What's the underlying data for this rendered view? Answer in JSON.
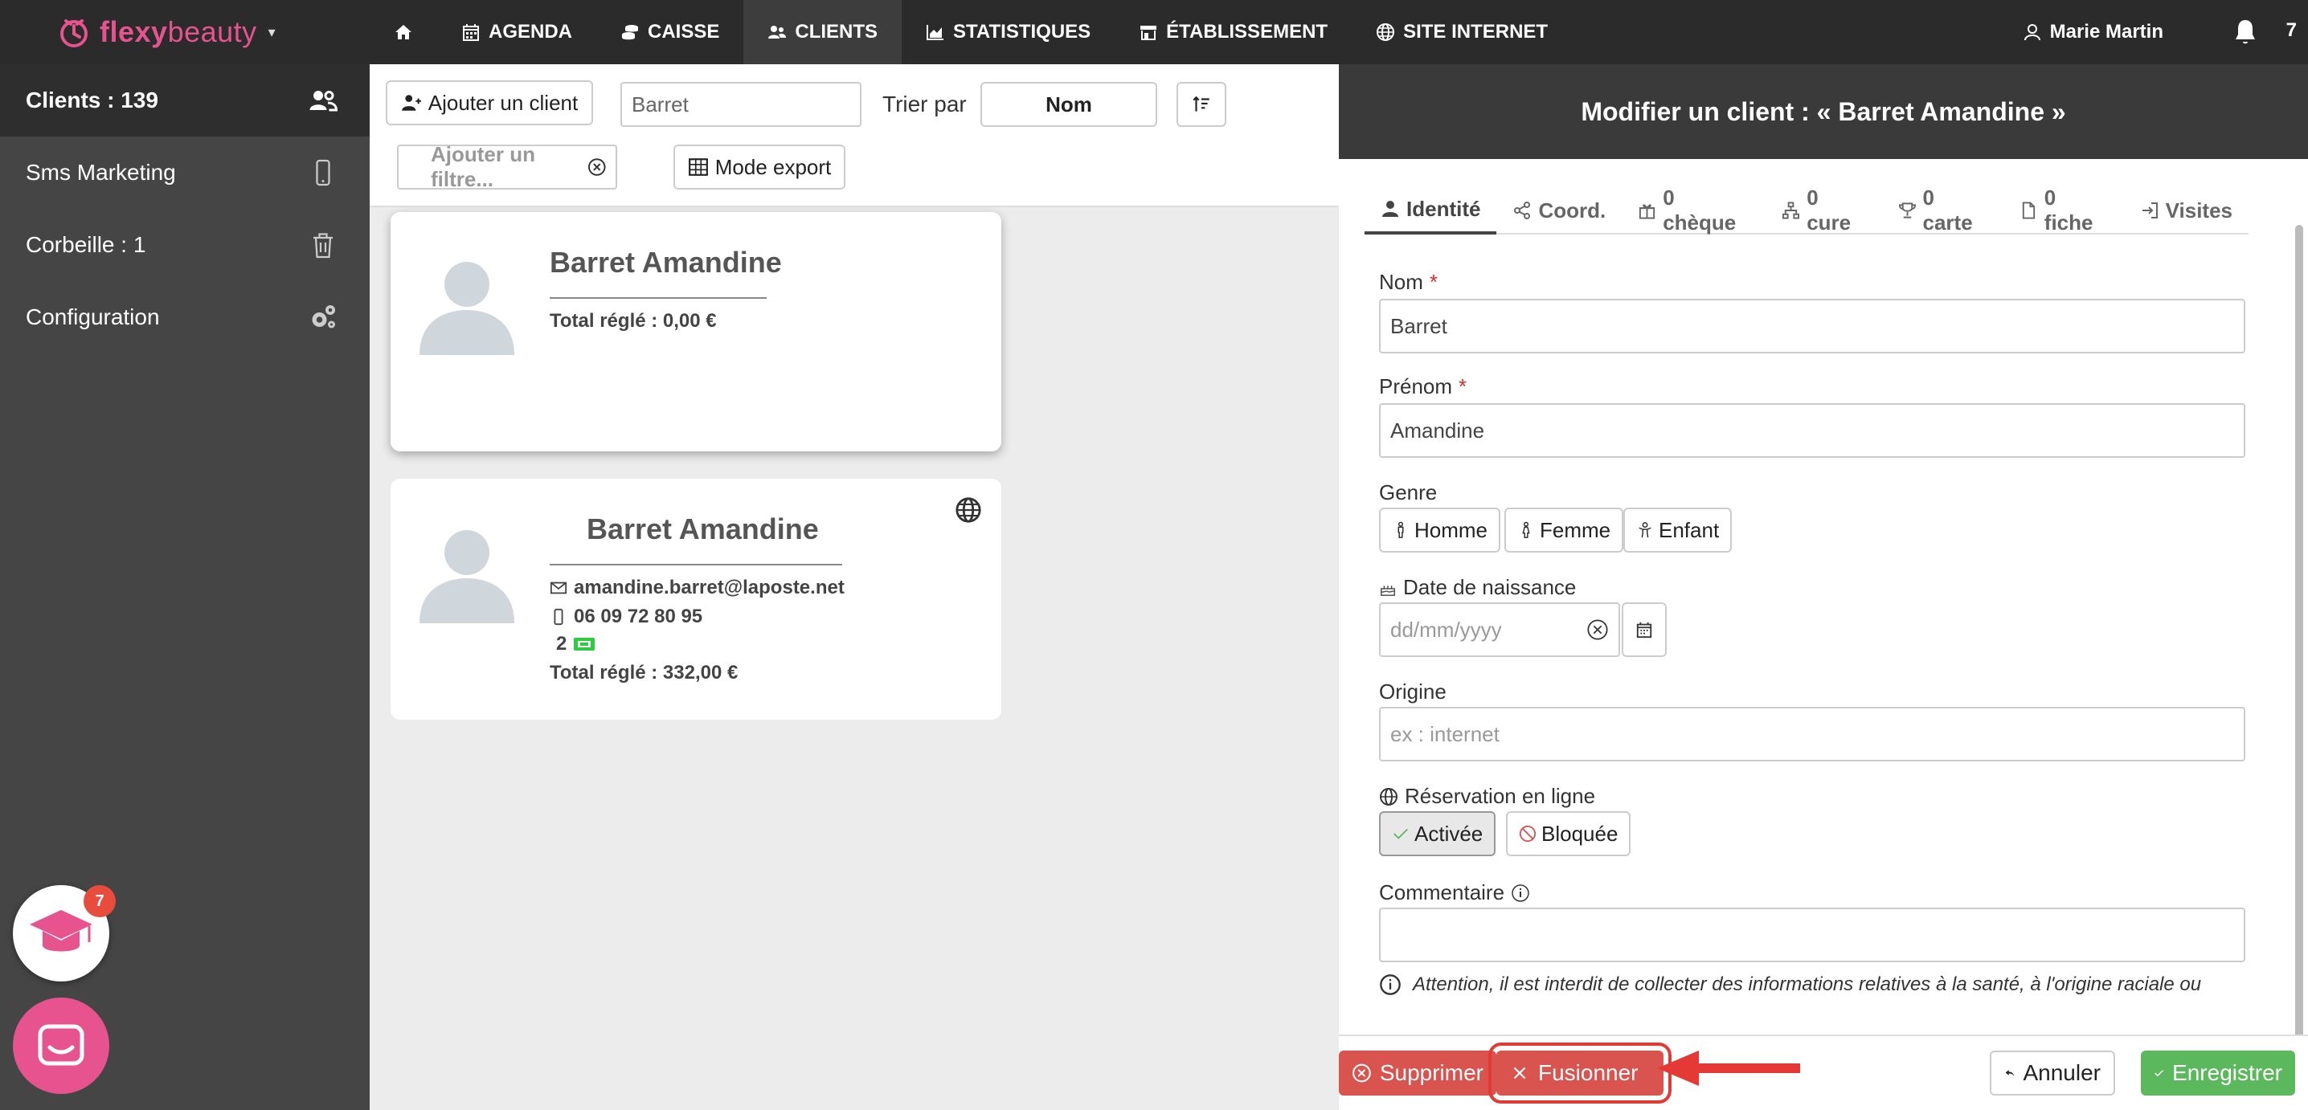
{
  "brand": {
    "name_part1": "flexy",
    "name_part2": "beauty"
  },
  "nav": {
    "items": [
      {
        "label": ""
      },
      {
        "label": "AGENDA"
      },
      {
        "label": "CAISSE"
      },
      {
        "label": "CLIENTS"
      },
      {
        "label": "STATISTIQUES"
      },
      {
        "label": "ÉTABLISSEMENT"
      },
      {
        "label": "SITE INTERNET"
      }
    ],
    "user": "Marie Martin",
    "notifications": "7"
  },
  "sidebar": {
    "items": [
      {
        "label": "Clients : 139",
        "icon": "users-icon"
      },
      {
        "label": "Sms Marketing",
        "icon": "mobile-icon"
      },
      {
        "label": "Corbeille : 1",
        "icon": "trash-icon"
      },
      {
        "label": "Configuration",
        "icon": "gears-icon"
      }
    ],
    "academy_badge": "7"
  },
  "toolbar": {
    "add_client": "Ajouter un client",
    "search_value": "Barret",
    "sort_label": "Trier par",
    "sort_value": "Nom",
    "filter_placeholder": "Ajouter un filtre...",
    "export_label": "Mode export"
  },
  "cards": [
    {
      "name": "Barret Amandine",
      "total": "Total réglé : 0,00 €"
    },
    {
      "name": "Barret Amandine",
      "email": "amandine.barret@laposte.net",
      "phone": "06 09 72 80 95",
      "tickets": "2",
      "total": "Total réglé : 332,00 €"
    }
  ],
  "panel": {
    "title": "Modifier un client : « Barret Amandine »",
    "tabs": [
      "Identité",
      "Coord.",
      "0 chèque",
      "0 cure",
      "0 carte",
      "0 fiche",
      "Visites"
    ],
    "nom_label": "Nom",
    "nom_value": "Barret",
    "prenom_label": "Prénom",
    "prenom_value": "Amandine",
    "required_mark": "*",
    "genre_label": "Genre",
    "genre_options": [
      "Homme",
      "Femme",
      "Enfant"
    ],
    "dob_label": "Date de naissance",
    "dob_placeholder": "dd/mm/yyyy",
    "origine_label": "Origine",
    "origine_placeholder": "ex : internet",
    "resa_label": "Réservation en ligne",
    "resa_on": "Activée",
    "resa_off": "Bloquée",
    "comment_label": "Commentaire",
    "warning": "Attention, il est interdit de collecter des informations relatives à la santé, à l'origine raciale ou"
  },
  "footer": {
    "delete": "Supprimer",
    "merge": "Fusionner",
    "cancel": "Annuler",
    "save": "Enregistrer"
  },
  "colors": {
    "brand": "#e6538f",
    "topbar": "#2b2b2b",
    "sidebar": "#454545",
    "danger": "#d9534f",
    "success": "#5cb85c",
    "highlight": "#e53935"
  }
}
